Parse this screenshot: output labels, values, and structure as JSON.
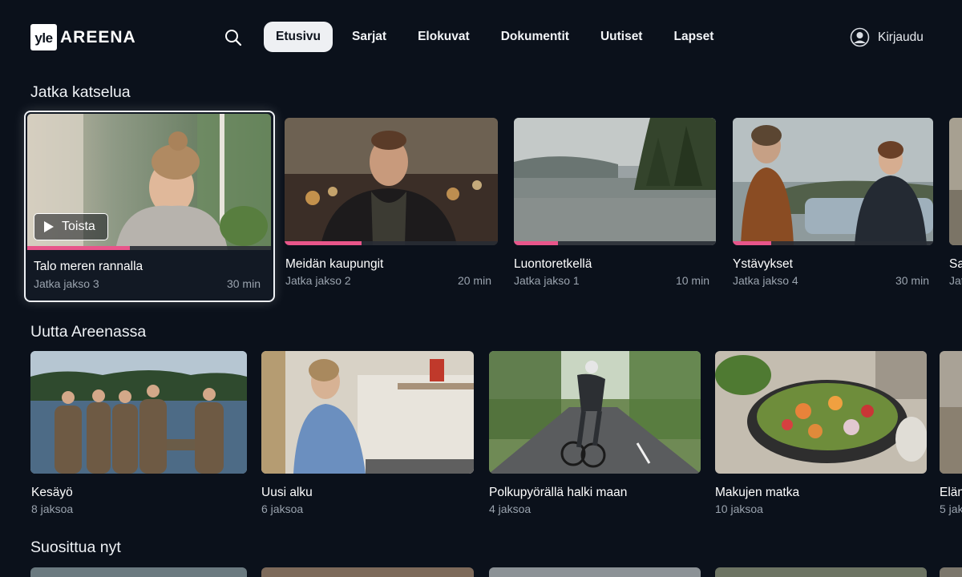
{
  "brand": {
    "badge": "yle",
    "name": "AREENA"
  },
  "nav": {
    "search_icon": "search-icon",
    "items": [
      "Etusivu",
      "Sarjat",
      "Elokuvat",
      "Dokumentit",
      "Uutiset",
      "Lapset"
    ],
    "active": "Etusivu"
  },
  "login": {
    "label": "Kirjaudu",
    "icon": "user-icon"
  },
  "sections": [
    {
      "title": "Jatka katselua",
      "cards": [
        {
          "title": "Talo meren rannalla",
          "subtitle": "Jatka jakso 3",
          "duration": "30 min",
          "progress": 0.42,
          "focused": true,
          "action": "Toista"
        },
        {
          "title": "Meidän kaupungit",
          "subtitle": "Jatka jakso 2",
          "duration": "20 min",
          "progress": 0.36
        },
        {
          "title": "Luontoretkellä",
          "subtitle": "Jatka jakso 1",
          "duration": "10 min",
          "progress": 0.22
        },
        {
          "title": "Ystävykset",
          "subtitle": "Jatka jakso 4",
          "duration": "30 min",
          "progress": 0.19
        },
        {
          "title": "Sa",
          "subtitle": "Jat",
          "duration": "",
          "progress": 0
        }
      ]
    },
    {
      "title": "Uutta Areenassa",
      "cards": [
        {
          "title": "Kesäyö",
          "subtitle": "8 jaksoa"
        },
        {
          "title": "Uusi alku",
          "subtitle": "6 jaksoa"
        },
        {
          "title": "Polkupyörällä halki maan",
          "subtitle": "4 jaksoa"
        },
        {
          "title": "Makujen matka",
          "subtitle": "10 jaksoa"
        },
        {
          "title": "Eläm",
          "subtitle": "5 jak"
        }
      ]
    },
    {
      "title": "Suosittua nyt",
      "cards": []
    }
  ],
  "colors": {
    "background": "#0b111b",
    "progress": "#e8558a",
    "active_nav": "#eef0f3"
  }
}
